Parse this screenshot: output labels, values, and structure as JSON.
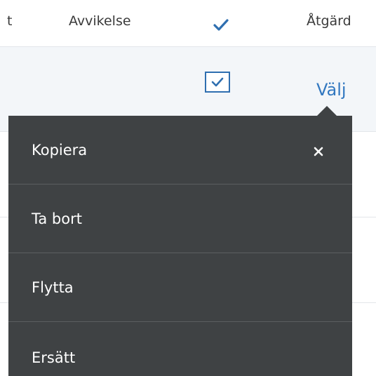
{
  "table": {
    "headers": {
      "col_partial": "t",
      "deviation": "Avvikelse",
      "check_icon": "checkmark-icon",
      "action": "Åtgärd"
    },
    "row": {
      "checkbox_checked": true,
      "action_link": "Välj"
    }
  },
  "context_menu": {
    "items": [
      {
        "label": "Kopiera",
        "has_close": true,
        "close_icon": "close-icon"
      },
      {
        "label": "Ta bort"
      },
      {
        "label": "Flytta"
      },
      {
        "label": "Ersätt"
      }
    ]
  },
  "colors": {
    "accent": "#3278c0",
    "menu_bg": "#3f4244",
    "row_highlight": "#f3f6f9"
  }
}
